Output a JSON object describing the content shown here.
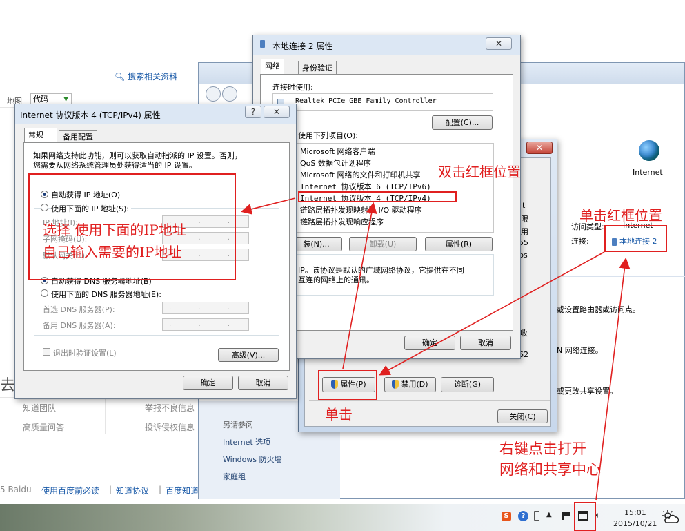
{
  "browser": {
    "search_related": "搜索相关资料",
    "nav_map": "地图",
    "nav_code": "代码",
    "side_char": "去",
    "links_col1": [
      "知道团队",
      "高质量问答"
    ],
    "links_col2": [
      "举报不良信息",
      "投诉侵权信息"
    ],
    "footer_prefix": "5 Baidu",
    "footer_links": [
      "使用百度前必读",
      "知道协议",
      "百度知道"
    ]
  },
  "network_center": {
    "internet_label": "Internet",
    "access_type_label": "访问类型:",
    "access_type_value": "Internet",
    "connection_label": "连接:",
    "connection_value": "本地连接 2",
    "task1": "或设置路由器或访问点。",
    "task2": "N 网络连接。",
    "task3": "或更改共享设置。",
    "see_also": "另请参阅",
    "side_links": [
      "Internet 选项",
      "Windows 防火墙",
      "家庭组"
    ]
  },
  "status_dialog": {
    "partial_values": [
      "t",
      "限",
      "用",
      "55",
      "ps"
    ],
    "activity_partial": "收",
    "bytes_partial": "62",
    "properties_button": "属性(P)",
    "disable_button": "禁用(D)",
    "diagnose_button": "诊断(G)",
    "close_button": "关闭(C)"
  },
  "conn_props": {
    "title": "本地连接 2 属性",
    "tabs": [
      "网络",
      "身份验证"
    ],
    "connect_using_label": "连接时使用:",
    "adapter": "Realtek PCIe GBE Family Controller",
    "configure_button": "配置(C)...",
    "items_label": "使用下列项目(O):",
    "items": [
      "Microsoft 网络客户端",
      "QoS 数据包计划程序",
      "Microsoft 网络的文件和打印机共享",
      "Internet 协议版本 6 (TCP/IPv6)",
      "Internet 协议版本 4 (TCP/IPv4)",
      "链路层拓扑发现映射器 I/O 驱动程序",
      "链路层拓扑发现响应程序"
    ],
    "install_button": "装(N)...",
    "uninstall_button": "卸载(U)",
    "properties_button": "属性(R)",
    "description": "IP。该协议是默认的广域网络协议，它提供在不同互连的网络上的通讯。",
    "description_line1": "IP。该协议是默认的广域网络协议，它提供在不同",
    "description_line2": "互连的网络上的通讯。",
    "ok_button": "确定",
    "cancel_button": "取消",
    "close_x": "✕"
  },
  "ipv4_dialog": {
    "title": "Internet 协议版本 4 (TCP/IPv4) 属性",
    "help": "?",
    "close_x": "✕",
    "tabs": [
      "常规",
      "备用配置"
    ],
    "intro_line1": "如果网络支持此功能，则可以获取自动指派的 IP 设置。否则，",
    "intro_line2": "您需要从网络系统管理员处获得适当的 IP 设置。",
    "auto_ip": "自动获得 IP 地址(O)",
    "manual_ip": "使用下面的 IP 地址(S):",
    "ip_label": "IP 地址(I):",
    "mask_label": "子网掩码(U):",
    "gateway_label": "默认网关(D):",
    "auto_dns": "自动获得 DNS 服务器地址(B)",
    "manual_dns": "使用下面的 DNS 服务器地址(E):",
    "pref_dns": "首选 DNS 服务器(P):",
    "alt_dns": "备用 DNS 服务器(A):",
    "validate": "退出时验证设置(L)",
    "advanced_button": "高级(V)...",
    "ok_button": "确定",
    "cancel_button": "取消",
    "ip_placeholder": ". . ."
  },
  "annotations": {
    "double_click": "双击红框位置",
    "single_click_box": "单击红框位置",
    "select_manual_line1": "选择 使用下面的IP地址",
    "select_manual_line2": "自己输入需要的IP地址",
    "single_click": "单击",
    "right_click_line1": "右键点击打开",
    "right_click_line2": "网络和共享中心"
  },
  "taskbar": {
    "time": "15:01",
    "date": "2015/10/21"
  },
  "colors": {
    "annotation_red": "#e02020",
    "link_blue": "#1a5aa8"
  }
}
